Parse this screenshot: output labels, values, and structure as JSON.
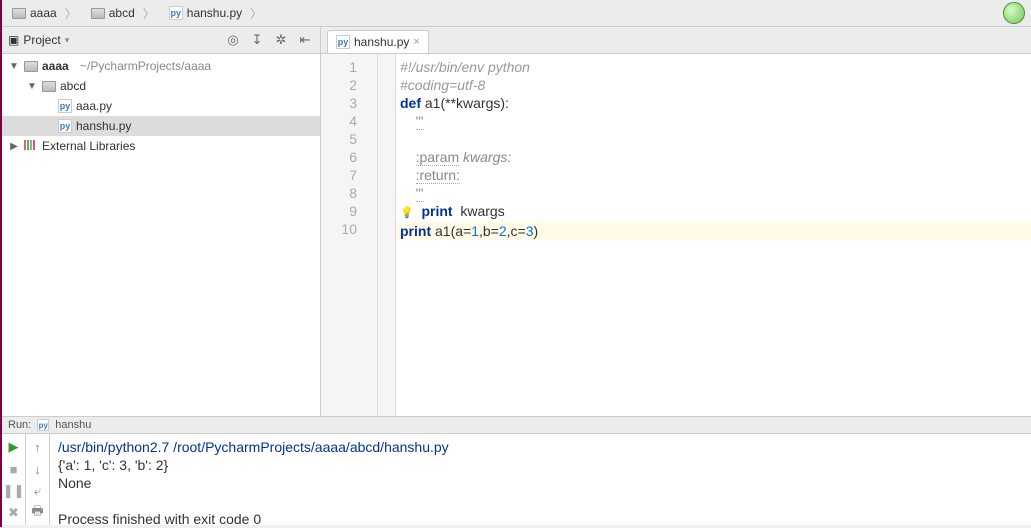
{
  "breadcrumb": {
    "items": [
      {
        "icon": "folder",
        "label": "aaaa"
      },
      {
        "icon": "folder",
        "label": "abcd"
      },
      {
        "icon": "py",
        "label": "hanshu.py"
      }
    ]
  },
  "sidebar": {
    "title": "Project",
    "tree": {
      "root": {
        "label": "aaaa",
        "path": "~/PycharmProjects/aaaa"
      },
      "folder": {
        "label": "abcd"
      },
      "files": [
        "aaa.py",
        "hanshu.py"
      ],
      "libs": "External Libraries"
    }
  },
  "editor": {
    "tab_name": "hanshu.py",
    "code": {
      "l1": "#!/usr/bin/env python",
      "l2": "#coding=utf-8",
      "l3a": "def",
      "l3b": " a1",
      "l3c": "(**kwargs):",
      "l4": "'''",
      "l6a": ":param",
      "l6b": " kwargs:",
      "l7": ":return:",
      "l8": "'''",
      "l9a": "print",
      "l9b": "  kwargs",
      "l10a": "print",
      "l10b": " a1(a=",
      "l10c": "1",
      "l10d": ",b=",
      "l10e": "2",
      "l10f": ",c=",
      "l10g": "3",
      "l10h": ")"
    },
    "lines": [
      "1",
      "2",
      "3",
      "4",
      "5",
      "6",
      "7",
      "8",
      "9",
      "10"
    ]
  },
  "run": {
    "title": "Run:",
    "name": "hanshu",
    "cmd": "/usr/bin/python2.7 /root/PycharmProjects/aaaa/abcd/hanshu.py",
    "out1": "{'a': 1, 'c': 3, 'b': 2}",
    "out2": "None",
    "exit": "Process finished with exit code 0"
  }
}
